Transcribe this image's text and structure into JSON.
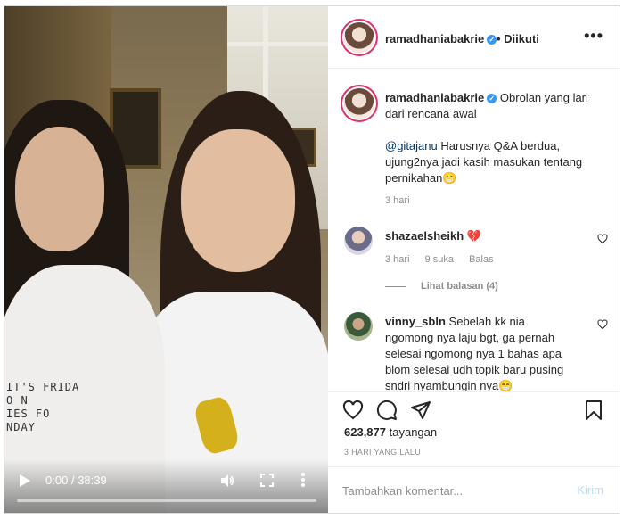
{
  "video": {
    "current_time": "0:00",
    "duration": "38:39",
    "time_separator": "/",
    "progress_fraction": 0.0,
    "shirt_print_lines": [
      "IT'S FRIDA",
      "O N",
      "IES FO",
      "NDAY"
    ]
  },
  "header": {
    "username": "ramadhaniabakrie",
    "follow_status": "• Diikuti",
    "more_icon": "more-horizontal-icon"
  },
  "caption": {
    "username": "ramadhaniabakrie",
    "text": "Obrolan yang lari dari rencana awal",
    "mention": "@gitajanu",
    "text2": "Harusnya Q&A berdua, ujung2nya jadi kasih masukan tentang pernikahan😁",
    "time": "3 hari"
  },
  "comments": [
    {
      "username": "shazaelsheikh",
      "text": "💔",
      "time": "3 hari",
      "likes": "9 suka",
      "reply": "Balas"
    },
    {
      "username": "vinny_sbln",
      "text": "Sebelah kk nia ngomong nya laju bgt, ga pernah selesai ngomong nya 1 bahas apa blom selesai udh topik baru pusing sndri nyambungin nya😁"
    }
  ],
  "view_replies": "Lihat balasan (4)",
  "stats": {
    "views_count": "623,877",
    "views_label": "tayangan",
    "post_time": "3 HARI YANG LALU"
  },
  "add_comment": {
    "placeholder": "Tambahkan komentar...",
    "post_label": "Kirim"
  },
  "colors": {
    "verified": "#3897f0",
    "link": "#00376b",
    "muted": "#8e8e8e",
    "post_disabled": "#b2dffc"
  }
}
